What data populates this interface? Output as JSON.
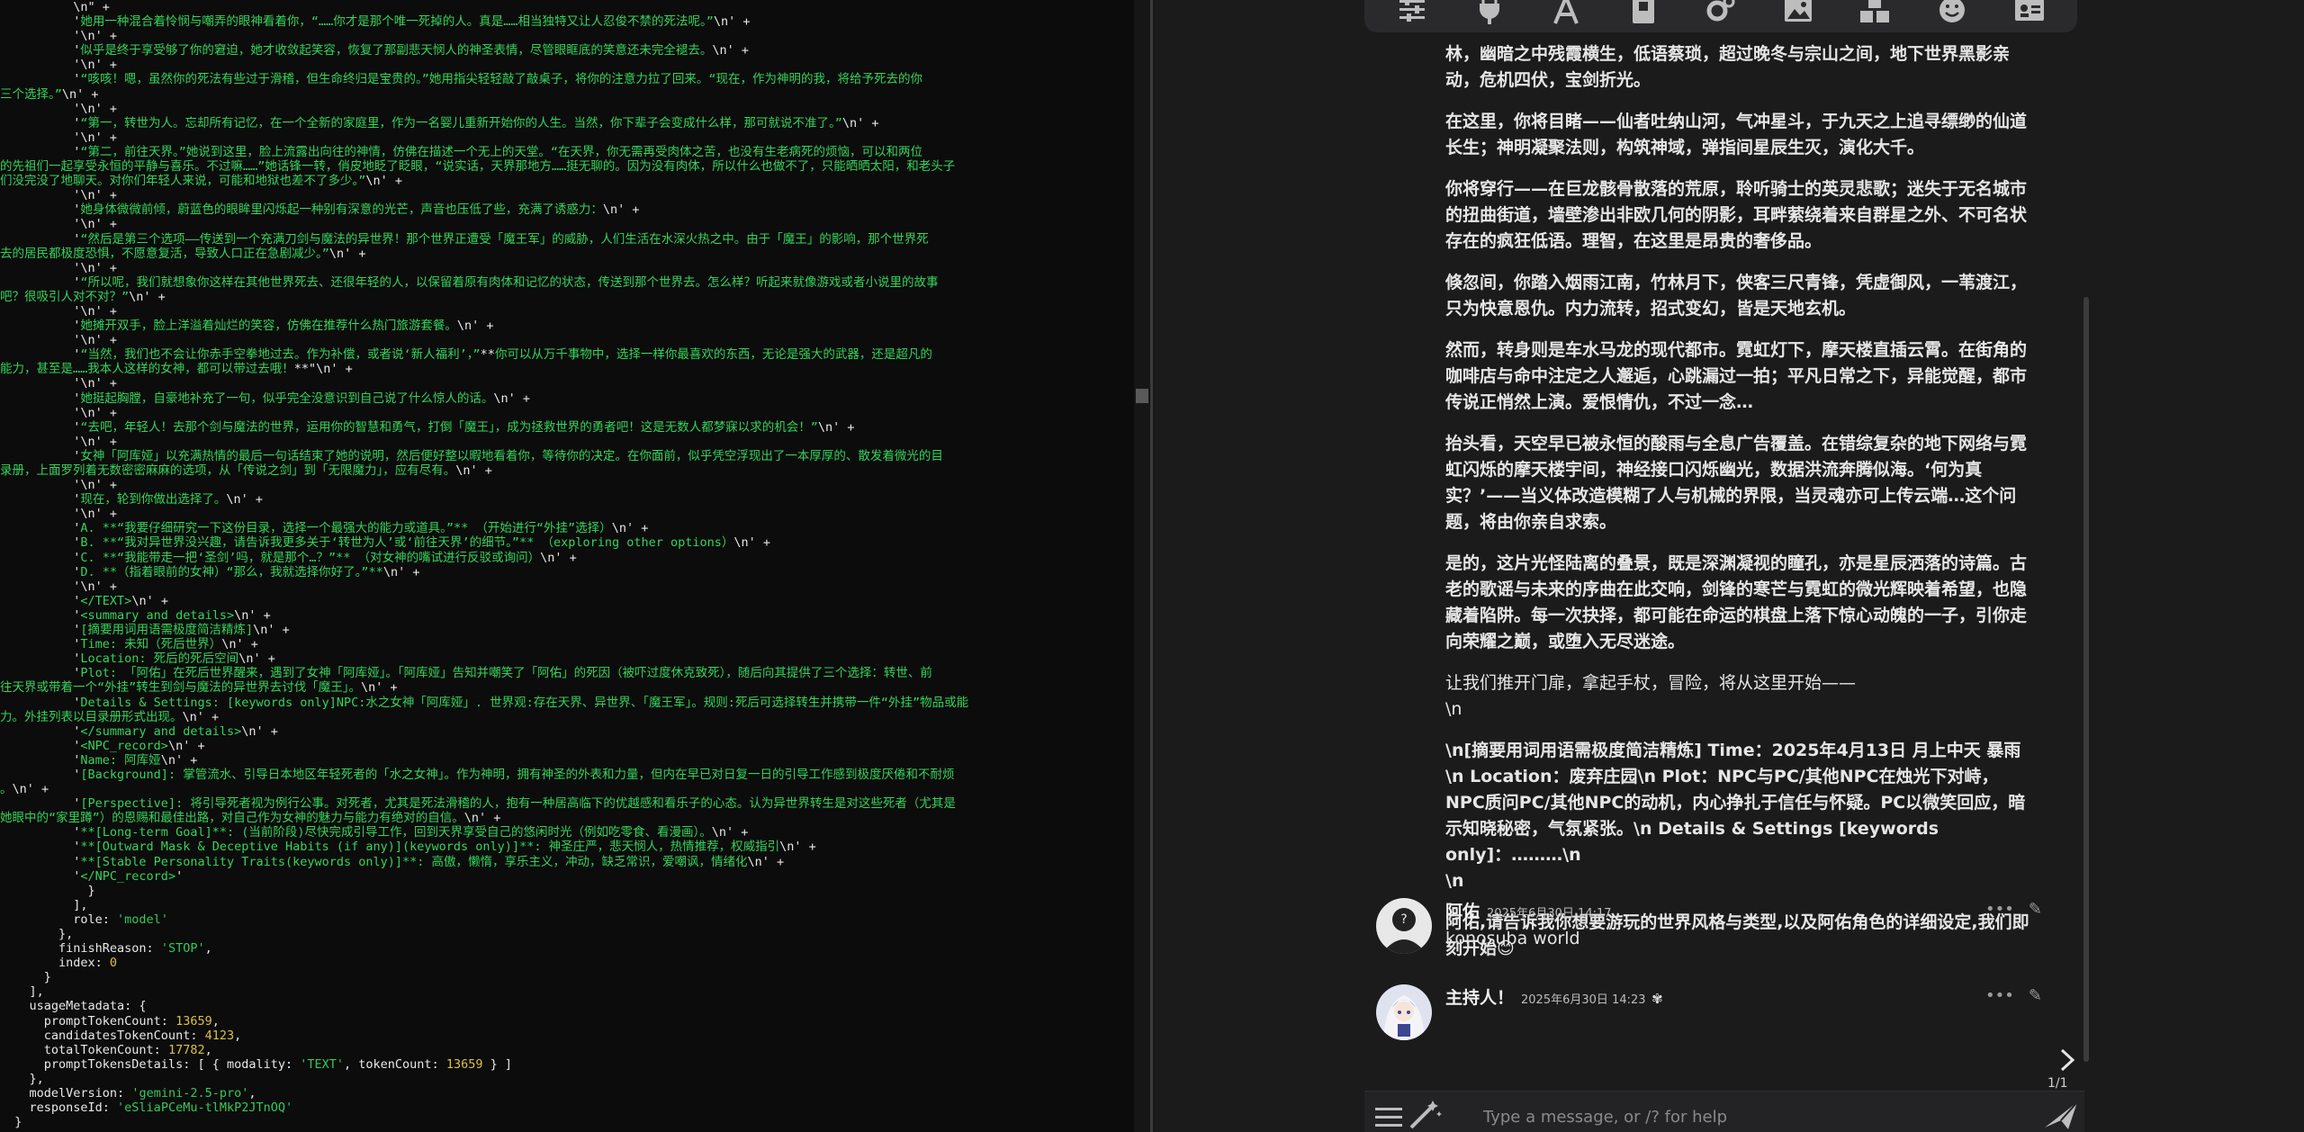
{
  "terminal": {
    "lines": [
      [
        [
          "w",
          "          \\n\" +"
        ]
      ],
      [
        [
          "w",
          "          '"
        ],
        [
          "g",
          "她用一种混合着怜悯与嘲弄的眼神看着你，“……你才是那个唯一死掉的人。真是……相当独特又让人忍俊不禁的死法呢。”"
        ],
        [
          "w",
          "\\n' +"
        ]
      ],
      [
        [
          "w",
          "          '\\n' +"
        ]
      ],
      [
        [
          "w",
          "          '"
        ],
        [
          "g",
          "似乎是终于享受够了你的窘迫，她才收敛起笑容，恢复了那副悲天悯人的神圣表情，尽管眼眶底的笑意还未完全褪去。"
        ],
        [
          "w",
          "\\n' +"
        ]
      ],
      [
        [
          "w",
          "          '\\n' +"
        ]
      ],
      [
        [
          "w",
          "          '"
        ],
        [
          "g",
          "“咳咳！嗯，虽然你的死法有些过于滑稽，但生命终归是宝贵的。”她用指尖轻轻敲了敲桌子，将你的注意力拉了回来。“现在，作为神明的我，将给予死去的你"
        ]
      ],
      [
        [
          "g",
          "三个选择。”"
        ],
        [
          "w",
          "\\n' +"
        ]
      ],
      [
        [
          "w",
          "          '\\n' +"
        ]
      ],
      [
        [
          "w",
          "          '"
        ],
        [
          "g",
          "“第一，转世为人。忘却所有记忆，在一个全新的家庭里，作为一名婴儿重新开始你的人生。当然，你下辈子会变成什么样，那可就说不准了。”"
        ],
        [
          "w",
          "\\n' +"
        ]
      ],
      [
        [
          "w",
          "          '\\n' +"
        ]
      ],
      [
        [
          "w",
          "          '"
        ],
        [
          "g",
          "“第二，前往天界。”她说到这里，脸上流露出向往的神情，仿佛在描述一个无上的天堂。“在天界，你无需再受肉体之苦，也没有生老病死的烦恼，可以和两位"
        ]
      ],
      [
        [
          "g",
          "的先祖们一起享受永恒的平静与喜乐。不过嘛……”她话锋一转，俏皮地眨了眨眼，“说实话，天界那地方……挺无聊的。因为没有肉体，所以什么也做不了，只能晒晒太阳，和老头子"
        ]
      ],
      [
        [
          "g",
          "们没完没了地聊天。对你们年轻人来说，可能和地狱也差不了多少。”"
        ],
        [
          "w",
          "\\n' +"
        ]
      ],
      [
        [
          "w",
          "          '\\n' +"
        ]
      ],
      [
        [
          "w",
          "          '"
        ],
        [
          "g",
          "她身体微微前倾，蔚蓝色的眼眸里闪烁起一种别有深意的光芒，声音也压低了些，充满了诱惑力："
        ],
        [
          "w",
          "\\n' +"
        ]
      ],
      [
        [
          "w",
          "          '\\n' +"
        ]
      ],
      [
        [
          "w",
          "          '"
        ],
        [
          "g",
          "“然后是第三个选项——传送到一个充满刀剑与魔法的异世界！那个世界正遭受「魔王军」的威胁，人们生活在水深火热之中。由于「魔王」的影响，那个世界死"
        ]
      ],
      [
        [
          "g",
          "去的居民都极度恐惧，不愿意复活，导致人口正在急剧减少。”"
        ],
        [
          "w",
          "\\n' +"
        ]
      ],
      [
        [
          "w",
          "          '\\n' +"
        ]
      ],
      [
        [
          "w",
          "          '"
        ],
        [
          "g",
          "“所以呢，我们就想象你这样在其他世界死去、还很年轻的人，以保留着原有肉体和记忆的状态，传送到那个世界去。怎么样？听起来就像游戏或者小说里的故事"
        ]
      ],
      [
        [
          "g",
          "吧？很吸引人对不对？”"
        ],
        [
          "w",
          "\\n' +"
        ]
      ],
      [
        [
          "w",
          "          '\\n' +"
        ]
      ],
      [
        [
          "w",
          "          '"
        ],
        [
          "g",
          "她摊开双手，脸上洋溢着灿烂的笑容，仿佛在推荐什么热门旅游套餐。"
        ],
        [
          "w",
          "\\n' +"
        ]
      ],
      [
        [
          "w",
          "          '\\n' +"
        ]
      ],
      [
        [
          "w",
          "          '"
        ],
        [
          "g",
          "“当然，我们也不会让你赤手空拳地过去。作为补偿，或者说‘新人福利’，”"
        ],
        [
          "w",
          "**"
        ],
        [
          "g",
          "你可以从万千事物中，选择一样你最喜欢的东西，无论是强大的武器，还是超凡的"
        ]
      ],
      [
        [
          "g",
          "能力，甚至是……我本人这样的女神，都可以带过去哦！"
        ],
        [
          "w",
          "**\"\\n' +"
        ]
      ],
      [
        [
          "w",
          "          '\\n' +"
        ]
      ],
      [
        [
          "w",
          "          '"
        ],
        [
          "g",
          "她挺起胸膛，自豪地补充了一句，似乎完全没意识到自己说了什么惊人的话。"
        ],
        [
          "w",
          "\\n' +"
        ]
      ],
      [
        [
          "w",
          "          '\\n' +"
        ]
      ],
      [
        [
          "w",
          "          '"
        ],
        [
          "g",
          "“去吧，年轻人！去那个剑与魔法的世界，运用你的智慧和勇气，打倒「魔王」，成为拯救世界的勇者吧！这是无数人都梦寐以求的机会！”"
        ],
        [
          "w",
          "\\n' +"
        ]
      ],
      [
        [
          "w",
          "          '\\n' +"
        ]
      ],
      [
        [
          "w",
          "          '"
        ],
        [
          "g",
          "女神「阿库娅」以充满热情的最后一句话结束了她的说明，然后便好整以暇地看着你，等待你的决定。在你面前，似乎凭空浮现出了一本厚厚的、散发着微光的目"
        ]
      ],
      [
        [
          "g",
          "录册，上面罗列着无数密密麻麻的选项，从「传说之剑」到「无限魔力」，应有尽有。"
        ],
        [
          "w",
          "\\n' +"
        ]
      ],
      [
        [
          "w",
          "          '\\n' +"
        ]
      ],
      [
        [
          "w",
          "          '"
        ],
        [
          "g",
          "现在，轮到你做出选择了。"
        ],
        [
          "w",
          "\\n' +"
        ]
      ],
      [
        [
          "w",
          "          '\\n' +"
        ]
      ],
      [
        [
          "w",
          "          '"
        ],
        [
          "g",
          "A. **“我要仔细研究一下这份目录，选择一个最强大的能力或道具。”** （开始进行“外挂”选择）"
        ],
        [
          "w",
          "\\n' +"
        ]
      ],
      [
        [
          "w",
          "          '"
        ],
        [
          "g",
          "B. **“我对异世界没兴趣，请告诉我更多关于‘转世为人’或‘前往天界’的细节。”** （exploring other options）"
        ],
        [
          "w",
          "\\n' +"
        ]
      ],
      [
        [
          "w",
          "          '"
        ],
        [
          "g",
          "C. **“我能带走一把‘圣剑’吗，就是那个…？”** （对女神的嘴试进行反驳或询问）"
        ],
        [
          "w",
          "\\n' +"
        ]
      ],
      [
        [
          "w",
          "          '"
        ],
        [
          "g",
          "D. **（指着眼前的女神）“那么，我就选择你好了。”**"
        ],
        [
          "w",
          "\\n' +"
        ]
      ],
      [
        [
          "w",
          "          '\\n' +"
        ]
      ],
      [
        [
          "w",
          "          '"
        ],
        [
          "g",
          "</TEXT>"
        ],
        [
          "w",
          "\\n' +"
        ]
      ],
      [
        [
          "w",
          "          '"
        ],
        [
          "g",
          "<summary and details>"
        ],
        [
          "w",
          "\\n' +"
        ]
      ],
      [
        [
          "w",
          "          '"
        ],
        [
          "g",
          "[摘要用词用语需极度简洁精炼]"
        ],
        [
          "w",
          "\\n' +"
        ]
      ],
      [
        [
          "w",
          "          '"
        ],
        [
          "g",
          "Time: 未知（死后世界）"
        ],
        [
          "w",
          "\\n' +"
        ]
      ],
      [
        [
          "w",
          "          '"
        ],
        [
          "g",
          "Location: 死后的死后空间"
        ],
        [
          "w",
          "\\n' +"
        ]
      ],
      [
        [
          "w",
          "          '"
        ],
        [
          "g",
          "Plot: 「阿佑」在死后世界醒来，遇到了女神「阿库娅」。「阿库娅」告知并嘲笑了「阿佑」的死因（被吓过度休克致死），随后向其提供了三个选择：转世、前"
        ]
      ],
      [
        [
          "g",
          "往天界或带着一个“外挂”转生到剑与魔法的异世界去讨伐「魔王」。"
        ],
        [
          "w",
          "\\n' +"
        ]
      ],
      [
        [
          "w",
          "          '"
        ],
        [
          "g",
          "Details & Settings: [keywords only]NPC:水之女神「阿库娅」. 世界观:存在天界、异世界、「魔王军」。规则:死后可选择转生并携带一件“外挂”物品或能"
        ]
      ],
      [
        [
          "g",
          "力。外挂列表以目录册形式出现。"
        ],
        [
          "w",
          "\\n' +"
        ]
      ],
      [
        [
          "w",
          "          '"
        ],
        [
          "g",
          "</summary and details>"
        ],
        [
          "w",
          "\\n' +"
        ]
      ],
      [
        [
          "w",
          "          '"
        ],
        [
          "g",
          "<NPC_record>"
        ],
        [
          "w",
          "\\n' +"
        ]
      ],
      [
        [
          "w",
          "          '"
        ],
        [
          "g",
          "Name: 阿库娅"
        ],
        [
          "w",
          "\\n' +"
        ]
      ],
      [
        [
          "w",
          "          '"
        ],
        [
          "g",
          "[Background]: 掌管流水、引导日本地区年轻死者的「水之女神」。作为神明，拥有神圣的外表和力量，但内在早已对日复一日的引导工作感到极度厌倦和不耐烦"
        ]
      ],
      [
        [
          "g",
          "。"
        ],
        [
          "w",
          "\\n' +"
        ]
      ],
      [
        [
          "w",
          "          '"
        ],
        [
          "g",
          "[Perspective]: 将引导死者视为例行公事。对死者，尤其是死法滑稽的人，抱有一种居高临下的优越感和看乐子的心态。认为异世界转生是对这些死者（尤其是"
        ]
      ],
      [
        [
          "g",
          "她眼中的“家里蹲”）的恩赐和最佳出路，对自己作为女神的魅力与能力有绝对的自信。"
        ],
        [
          "w",
          "\\n' +"
        ]
      ],
      [
        [
          "w",
          "          '"
        ],
        [
          "g",
          "**[Long-term Goal]**: (当前阶段)尽快完成引导工作，回到天界享受自己的悠闲时光（例如吃零食、看漫画）。"
        ],
        [
          "w",
          "\\n' +"
        ]
      ],
      [
        [
          "w",
          "          '"
        ],
        [
          "g",
          "**[Outward Mask & Deceptive Habits (if any)](keywords only)]**: 神圣庄严，悲天悯人，热情推荐，权威指引"
        ],
        [
          "w",
          "\\n' +"
        ]
      ],
      [
        [
          "w",
          "          '"
        ],
        [
          "g",
          "**[Stable Personality Traits(keywords only)]**: 高傲，懒惰，享乐主义，冲动，缺乏常识，爱嘲讽，情绪化"
        ],
        [
          "w",
          "\\n' +"
        ]
      ],
      [
        [
          "w",
          "          '"
        ],
        [
          "g",
          "</NPC_record>"
        ],
        [
          "w",
          "'"
        ]
      ],
      [
        [
          "w",
          "            }"
        ]
      ],
      [
        [
          "w",
          "          ],"
        ]
      ],
      [
        [
          "w",
          "          role: "
        ],
        [
          "s",
          "'model'"
        ]
      ],
      [
        [
          "w",
          "        },"
        ]
      ],
      [
        [
          "w",
          "        finishReason: "
        ],
        [
          "s",
          "'STOP'"
        ],
        [
          "w",
          ","
        ]
      ],
      [
        [
          "w",
          "        index: "
        ],
        [
          "y",
          "0"
        ]
      ],
      [
        [
          "w",
          "      }"
        ]
      ],
      [
        [
          "w",
          "    ],"
        ]
      ],
      [
        [
          "w",
          "    usageMetadata: {"
        ]
      ],
      [
        [
          "w",
          "      promptTokenCount: "
        ],
        [
          "y",
          "13659"
        ],
        [
          "w",
          ","
        ]
      ],
      [
        [
          "w",
          "      candidatesTokenCount: "
        ],
        [
          "y",
          "4123"
        ],
        [
          "w",
          ","
        ]
      ],
      [
        [
          "w",
          "      totalTokenCount: "
        ],
        [
          "y",
          "17782"
        ],
        [
          "w",
          ","
        ]
      ],
      [
        [
          "w",
          "      promptTokensDetails: [ { modality: "
        ],
        [
          "s",
          "'TEXT'"
        ],
        [
          "w",
          ", tokenCount: "
        ],
        [
          "y",
          "13659"
        ],
        [
          "w",
          " } ]"
        ]
      ],
      [
        [
          "w",
          "    },"
        ]
      ],
      [
        [
          "w",
          "    modelVersion: "
        ],
        [
          "s",
          "'gemini-2.5-pro'"
        ],
        [
          "w",
          ","
        ]
      ],
      [
        [
          "w",
          "    responseId: "
        ],
        [
          "s",
          "'eSliaPCeMu-tlMkP2JTnOQ'"
        ]
      ],
      [
        [
          "w",
          "  }"
        ]
      ]
    ]
  },
  "chat": {
    "toolbar_icons": [
      "sliders-icon",
      "plug-icon",
      "font-icon",
      "book-icon",
      "gears-icon",
      "image-icon",
      "cubes-icon",
      "face-smile-icon",
      "id-card-icon"
    ],
    "bot_paragraphs": [
      {
        "bold": true,
        "text": "林，幽暗之中残霞横生，低语蔡琐，超过晚冬与宗山之间，地下世界黑影亲动，危机四伏，宝剑折光。"
      },
      {
        "bold": true,
        "text": "在这里，你将目睹——仙者吐纳山河，气冲星斗，于九天之上追寻缥缈的仙道长生；神明凝聚法则，构筑神域，弹指间星辰生灭，演化大千。"
      },
      {
        "bold": true,
        "text": "你将穿行——在巨龙骸骨散落的荒原，聆听骑士的英灵悲歌；迷失于无名城市的扭曲街道，墙壁渗出非欧几何的阴影，耳畔萦绕着来自群星之外、不可名状存在的疯狂低语。理智，在这里是昂贵的奢侈品。"
      },
      {
        "bold": true,
        "text": "倏忽间，你踏入烟雨江南，竹林月下，侠客三尺青锋，凭虚御风，一苇渡江，只为快意恩仇。内力流转，招式变幻，皆是天地玄机。"
      },
      {
        "bold": true,
        "text": "然而，转身则是车水马龙的现代都市。霓虹灯下，摩天楼直插云霄。在街角的咖啡店与命中注定之人邂逅，心跳漏过一拍；平凡日常之下，异能觉醒，都市传说正悄然上演。爱恨情仇，不过一念…"
      },
      {
        "bold": true,
        "text": "抬头看，天空早已被永恒的酸雨与全息广告覆盖。在错综复杂的地下网络与霓虹闪烁的摩天楼宇间，神经接口闪烁幽光，数据洪流奔腾似海。‘何为真实？’——当义体改造模糊了人与机械的界限，当灵魂亦可上传云端…这个问题，将由你亲自求索。"
      },
      {
        "bold": true,
        "text": "是的，这片光怪陆离的叠景，既是深渊凝视的瞳孔，亦是星辰洒落的诗篇。古老的歌谣与未来的序曲在此交响，剑锋的寒芒与霓虹的微光辉映着希望，也隐藏着陷阱。每一次抉择，都可能在命运的棋盘上落下惊心动魄的一子，引你走向荣耀之巅，或堕入无尽迷途。"
      },
      {
        "bold": false,
        "text": "让我们推开门扉，拿起手杖，冒险，将从这里开始——\n\\n"
      },
      {
        "bold": true,
        "text": "\\n[摘要用词用语需极度简洁精炼] Time：2025年4月13日 月上中天 暴雨\\n Location：废弃庄园\\n Plot：NPC与PC/其他NPC在烛光下对峙，NPC质问PC/其他NPC的动机，内心挣扎于信任与怀疑。PC以微笑回应，暗示知晓秘密，气氛紧张。\\n Details & Settings [keywords only]：………\\n\n\\n"
      },
      {
        "bold": true,
        "text": "阿佑,请告诉我你想要游玩的世界风格与类型,以及阿佑角色的详细设定,我们即刻开始😊"
      }
    ],
    "messages": [
      {
        "name": "阿佑",
        "time": "2025年6月30日 14:17",
        "text": "konosuba world",
        "badge": ""
      },
      {
        "name": "主持人！",
        "time": "2025年6月30日 14:23",
        "text": "",
        "badge": "✾"
      }
    ],
    "swipe_counter": "1/1",
    "input_placeholder": "Type a message, or /? for help"
  }
}
